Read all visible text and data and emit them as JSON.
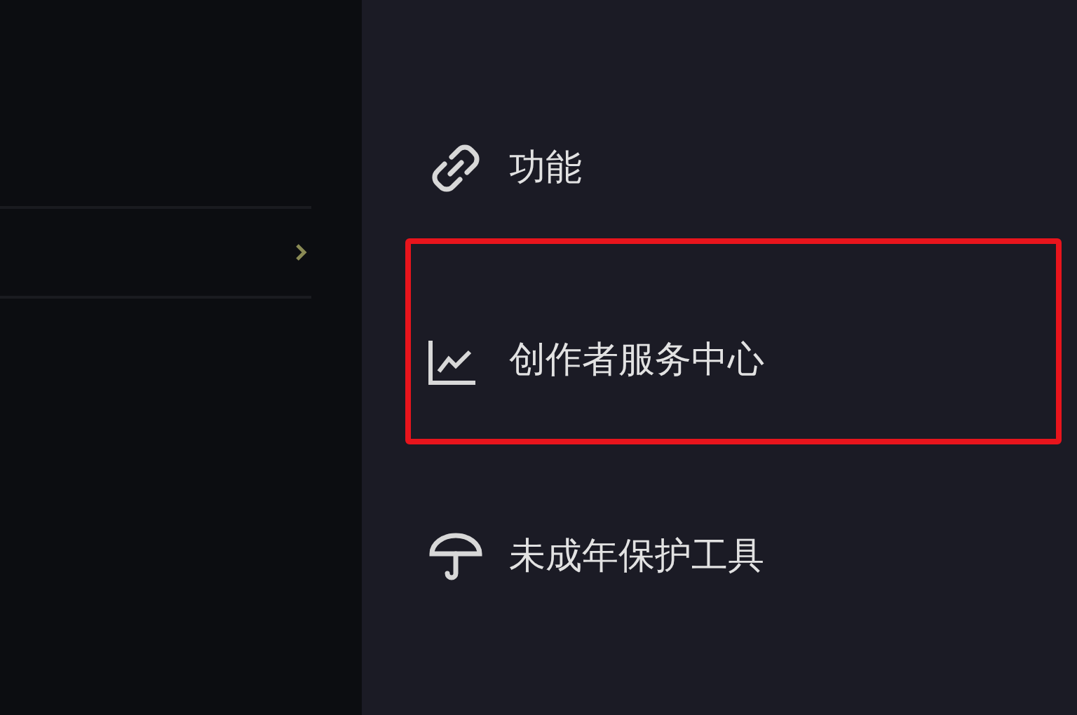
{
  "menu": {
    "items": [
      {
        "kind": "link",
        "label": "功能",
        "highlighted": false
      },
      {
        "kind": "chart",
        "label": "创作者服务中心",
        "highlighted": true
      },
      {
        "kind": "umbrella",
        "label": "未成年保护工具",
        "highlighted": false
      }
    ]
  }
}
